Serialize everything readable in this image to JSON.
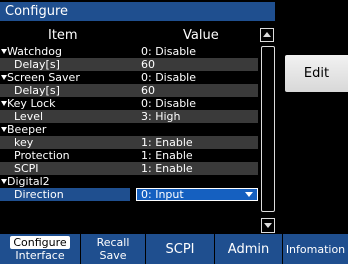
{
  "window": {
    "title": "Configure"
  },
  "table": {
    "header_item": "Item",
    "header_value": "Value",
    "rows": [
      {
        "item": "Watchdog",
        "value": "0: Disable"
      },
      {
        "item": "Delay[s]",
        "value": "60"
      },
      {
        "item": "Screen Saver",
        "value": "0: Disable"
      },
      {
        "item": "Delay[s]",
        "value": "60"
      },
      {
        "item": "Key Lock",
        "value": "0: Disable"
      },
      {
        "item": "Level",
        "value": "3: High"
      },
      {
        "item": "Beeper",
        "value": ""
      },
      {
        "item": "key",
        "value": "1: Enable"
      },
      {
        "item": "Protection",
        "value": "1: Enable"
      },
      {
        "item": "SCPI",
        "value": "1: Enable"
      },
      {
        "item": "Digital2",
        "value": ""
      },
      {
        "item": "Direction",
        "value": "0: Input"
      }
    ]
  },
  "side": {
    "edit_label": "Edit"
  },
  "softkeys": {
    "configure_l1": "Configure",
    "configure_l2": "Interface",
    "recall_l1": "Recall",
    "recall_l2": "Save",
    "scpi": "SCPI",
    "admin": "Admin",
    "info": "Infomation"
  },
  "icons": {
    "scroll_up": "triangle-up-icon",
    "scroll_down": "triangle-down-icon",
    "expand": "triangle-down-icon",
    "dropdown": "chevron-down-icon"
  },
  "colors": {
    "accent": "#1f4f8f",
    "selected_field": "#1560c0",
    "row_shade": "#3a3a3a",
    "edit_button": "#e6e6e6"
  }
}
